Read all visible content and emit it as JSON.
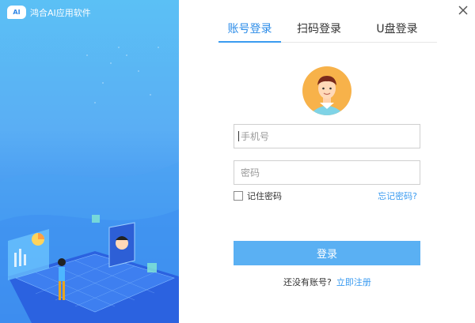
{
  "brand": {
    "logo_text": "AI",
    "name": "鸿合AI应用软件",
    "icon": "brand-logo-icon"
  },
  "window": {
    "close_icon": "close-icon"
  },
  "tabs": [
    {
      "label": "账号登录",
      "active": true
    },
    {
      "label": "扫码登录",
      "active": false
    },
    {
      "label": "U盘登录",
      "active": false
    }
  ],
  "avatar": {
    "icon": "user-avatar-icon"
  },
  "form": {
    "phone_placeholder": "手机号",
    "phone_value": "",
    "password_placeholder": "密码",
    "password_value": "",
    "remember_label": "记住密码",
    "remember_checked": false,
    "forgot_label": "忘记密码?",
    "login_label": "登录"
  },
  "register": {
    "prompt": "还没有账号?",
    "link": "立即注册"
  },
  "colors": {
    "accent": "#3a9bf0",
    "button": "#5ab0f3",
    "panel_top": "#5bc0f5",
    "panel_bottom": "#2f6de6"
  }
}
